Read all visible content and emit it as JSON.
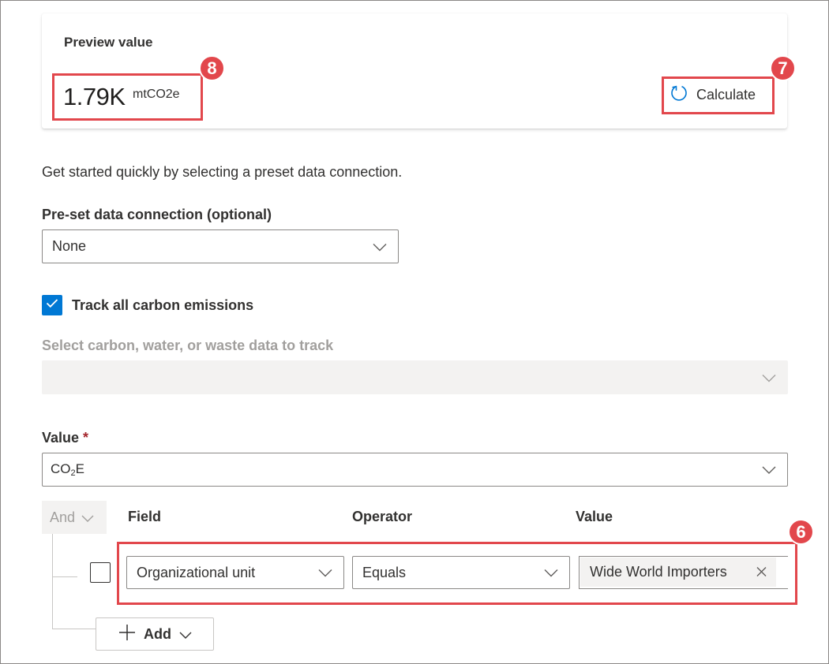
{
  "preview": {
    "title": "Preview value",
    "value": "1.79K",
    "unit": "mtCO2e",
    "calculate_label": "Calculate"
  },
  "callouts": {
    "value_badge": "8",
    "calculate_badge": "7",
    "filter_row_badge": "6"
  },
  "intro_text": "Get started quickly by selecting a preset data connection.",
  "preset": {
    "label": "Pre-set data connection (optional)",
    "selected": "None"
  },
  "track_all": {
    "label": "Track all carbon emissions",
    "checked": true
  },
  "select_data": {
    "label": "Select carbon, water, or waste data to track",
    "selected": ""
  },
  "value_field": {
    "label": "Value",
    "required_mark": "*",
    "selected_main": "CO",
    "selected_sub": "2",
    "selected_tail": "E"
  },
  "filter": {
    "and_label": "And",
    "headers": {
      "field": "Field",
      "operator": "Operator",
      "value": "Value"
    },
    "row": {
      "field": "Organizational unit",
      "operator": "Equals",
      "value_tag": "Wide World Importers"
    },
    "add_label": "Add"
  },
  "colors": {
    "accent": "#0078d4",
    "callout": "#e2474c",
    "required": "#a4262c"
  }
}
